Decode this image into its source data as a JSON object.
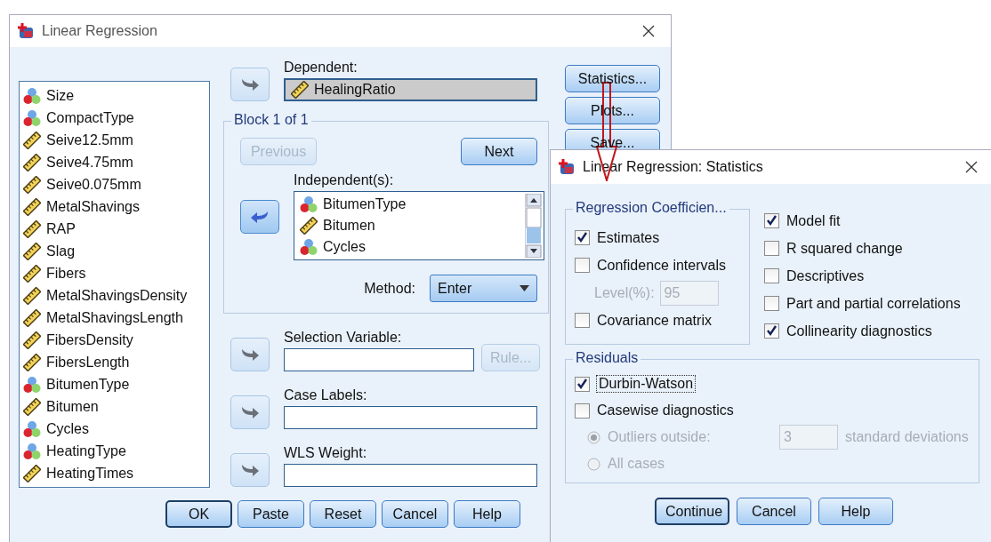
{
  "main_window": {
    "title": "Linear Regression",
    "variables": [
      {
        "name": "Size",
        "kind": "nominal"
      },
      {
        "name": "CompactType",
        "kind": "nominal"
      },
      {
        "name": "Seive12.5mm",
        "kind": "scale"
      },
      {
        "name": "Seive4.75mm",
        "kind": "scale"
      },
      {
        "name": "Seive0.075mm",
        "kind": "scale"
      },
      {
        "name": "MetalShavings",
        "kind": "scale"
      },
      {
        "name": "RAP",
        "kind": "scale"
      },
      {
        "name": "Slag",
        "kind": "scale"
      },
      {
        "name": "Fibers",
        "kind": "scale"
      },
      {
        "name": "MetalShavingsDensity",
        "kind": "scale"
      },
      {
        "name": "MetalShavingsLength",
        "kind": "scale"
      },
      {
        "name": "FibersDensity",
        "kind": "scale"
      },
      {
        "name": "FibersLength",
        "kind": "scale"
      },
      {
        "name": "BitumenType",
        "kind": "nominal"
      },
      {
        "name": "Bitumen",
        "kind": "scale"
      },
      {
        "name": "Cycles",
        "kind": "nominal"
      },
      {
        "name": "HeatingType",
        "kind": "nominal"
      },
      {
        "name": "HeatingTimes",
        "kind": "scale"
      }
    ],
    "dependent": {
      "label": "Dependent:",
      "variable": {
        "name": "HealingRatio",
        "kind": "scale"
      }
    },
    "block": {
      "title": "Block 1 of 1",
      "nav_buttons": [
        {
          "label": "Previous",
          "disabled": true
        },
        {
          "label": "Next",
          "disabled": false
        }
      ],
      "independents_label": "Independent(s):",
      "independents": [
        {
          "name": "BitumenType",
          "kind": "nominal"
        },
        {
          "name": "Bitumen",
          "kind": "scale"
        },
        {
          "name": "Cycles",
          "kind": "nominal"
        }
      ],
      "method_label": "Method:",
      "method": "Enter"
    },
    "selection_variable": {
      "label": "Selection Variable:",
      "rule_button": {
        "label": "Rule...",
        "disabled": true
      }
    },
    "case_labels": {
      "label": "Case Labels:"
    },
    "wls_weight": {
      "label": "WLS Weight:"
    },
    "side_buttons": [
      "Statistics...",
      "Plots...",
      "Save..."
    ],
    "buttons": [
      "OK",
      "Paste",
      "Reset",
      "Cancel",
      "Help"
    ]
  },
  "statistics_window": {
    "title": "Linear Regression: Statistics",
    "coefficients": {
      "title": "Regression Coefficien...",
      "options": [
        {
          "kind": "checkbox",
          "label": "Estimates",
          "checked": true
        },
        {
          "kind": "checkbox",
          "label": "Confidence intervals",
          "checked": false
        },
        {
          "kind": "level",
          "label": "Level(%):",
          "value": "95",
          "disabled": true
        },
        {
          "kind": "checkbox",
          "label": "Covariance matrix",
          "checked": false
        }
      ]
    },
    "options": [
      {
        "label": "Model fit",
        "checked": true
      },
      {
        "label": "R squared change",
        "checked": false
      },
      {
        "label": "Descriptives",
        "checked": false
      },
      {
        "label": "Part and partial correlations",
        "checked": false
      },
      {
        "label": "Collinearity diagnostics",
        "checked": true
      }
    ],
    "residuals": {
      "title": "Residuals",
      "checks": [
        {
          "label": "Durbin-Watson",
          "checked": true,
          "focused": true
        },
        {
          "label": "Casewise diagnostics",
          "checked": false,
          "focused": false
        }
      ],
      "radios": [
        {
          "label": "Outliers outside:",
          "selected": true,
          "disabled": true,
          "value": "3",
          "unit": "standard deviations"
        },
        {
          "label": "All cases",
          "selected": false,
          "disabled": true
        }
      ]
    },
    "buttons": [
      "Continue",
      "Cancel",
      "Help"
    ]
  }
}
